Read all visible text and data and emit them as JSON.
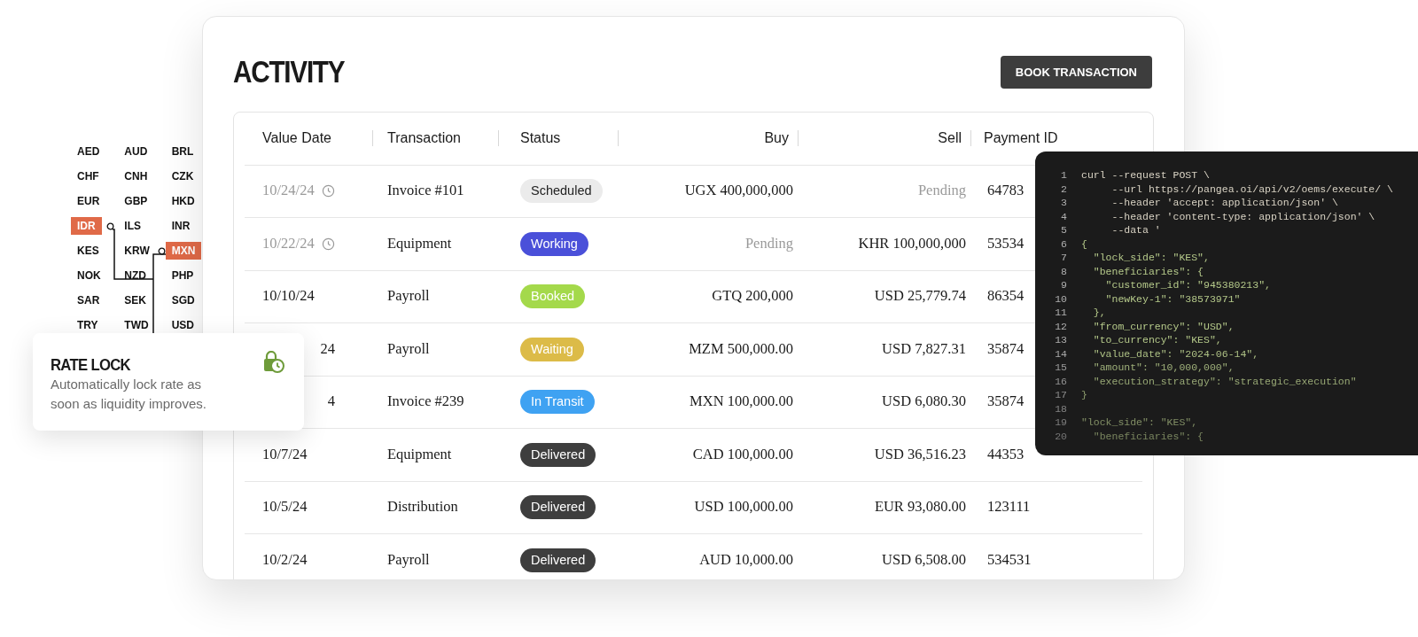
{
  "activity": {
    "title": "ACTIVITY",
    "book_button": "BOOK TRANSACTION",
    "columns": [
      "Value Date",
      "Transaction",
      "Status",
      "Buy",
      "Sell",
      "Payment ID"
    ],
    "rows": [
      {
        "date": "10/24/24",
        "scheduled": true,
        "clipped": false,
        "transaction": "Invoice #101",
        "status": "Scheduled",
        "color": "#ebebeb",
        "buy": "UGX 400,000,000",
        "buy_pending": false,
        "sell": "Pending",
        "sell_pending": true,
        "payment_id": "64783"
      },
      {
        "date": "10/22/24",
        "scheduled": true,
        "clipped": false,
        "transaction": "Equipment",
        "status": "Working",
        "color": "#4a50d9",
        "buy": "Pending",
        "buy_pending": true,
        "sell": "KHR 100,000,000",
        "sell_pending": false,
        "payment_id": "53534"
      },
      {
        "date": "10/10/24",
        "scheduled": false,
        "clipped": false,
        "transaction": "Payroll",
        "status": "Booked",
        "color": "#a4d94b",
        "buy": "GTQ 200,000",
        "buy_pending": false,
        "sell": "USD 25,779.74",
        "sell_pending": false,
        "payment_id": "86354"
      },
      {
        "date": "24",
        "scheduled": false,
        "clipped": true,
        "transaction": "Payroll",
        "status": "Waiting",
        "color": "#dcbb48",
        "buy": "MZM 500,000.00",
        "buy_pending": false,
        "sell": "USD 7,827.31",
        "sell_pending": false,
        "payment_id": "35874"
      },
      {
        "date": "4",
        "scheduled": false,
        "clipped": true,
        "transaction": "Invoice #239",
        "status": "In Transit",
        "color": "#3fa2f2",
        "buy": "MXN 100,000.00",
        "buy_pending": false,
        "sell": "USD 6,080.30",
        "sell_pending": false,
        "payment_id": "35874"
      },
      {
        "date": "10/7/24",
        "scheduled": false,
        "clipped": false,
        "transaction": "Equipment",
        "status": "Delivered",
        "color": "#3e3e3e",
        "buy": "CAD 100,000.00",
        "buy_pending": false,
        "sell": "USD 36,516.23",
        "sell_pending": false,
        "payment_id": "44353"
      },
      {
        "date": "10/5/24",
        "scheduled": false,
        "clipped": false,
        "transaction": "Distribution",
        "status": "Delivered",
        "color": "#3e3e3e",
        "buy": "USD 100,000.00",
        "buy_pending": false,
        "sell": "EUR 93,080.00",
        "sell_pending": false,
        "payment_id": "123111"
      },
      {
        "date": "10/2/24",
        "scheduled": false,
        "clipped": false,
        "transaction": "Payroll",
        "status": "Delivered",
        "color": "#3e3e3e",
        "buy": "AUD 10,000.00",
        "buy_pending": false,
        "sell": "USD 6,508.00",
        "sell_pending": false,
        "payment_id": "534531"
      }
    ]
  },
  "currencies": [
    [
      {
        "code": "AED",
        "selected": false
      },
      {
        "code": "AUD",
        "selected": false
      },
      {
        "code": "BRL",
        "selected": false
      }
    ],
    [
      {
        "code": "CHF",
        "selected": false
      },
      {
        "code": "CNH",
        "selected": false
      },
      {
        "code": "CZK",
        "selected": false
      }
    ],
    [
      {
        "code": "EUR",
        "selected": false
      },
      {
        "code": "GBP",
        "selected": false
      },
      {
        "code": "HKD",
        "selected": false
      }
    ],
    [
      {
        "code": "IDR",
        "selected": true
      },
      {
        "code": "ILS",
        "selected": false
      },
      {
        "code": "INR",
        "selected": false
      }
    ],
    [
      {
        "code": "KES",
        "selected": false
      },
      {
        "code": "KRW",
        "selected": false
      },
      {
        "code": "MXN",
        "selected": true
      }
    ],
    [
      {
        "code": "NOK",
        "selected": false
      },
      {
        "code": "NZD",
        "selected": false
      },
      {
        "code": "PHP",
        "selected": false
      }
    ],
    [
      {
        "code": "SAR",
        "selected": false
      },
      {
        "code": "SEK",
        "selected": false
      },
      {
        "code": "SGD",
        "selected": false
      }
    ],
    [
      {
        "code": "TRY",
        "selected": false
      },
      {
        "code": "TWD",
        "selected": false
      },
      {
        "code": "USD",
        "selected": false
      }
    ]
  ],
  "rate_lock": {
    "title": "RATE LOCK",
    "description": "Automatically lock rate as soon as liquidity improves."
  },
  "code": [
    {
      "number": "1",
      "text": "curl --request POST \\",
      "kind": "cmd"
    },
    {
      "number": "2",
      "text": "     --url https://pangea.oi/api/v2/oems/execute/ \\",
      "kind": "cmd"
    },
    {
      "number": "3",
      "text": "     --header 'accept: application/json' \\",
      "kind": "cmd"
    },
    {
      "number": "4",
      "text": "     --header 'content-type: application/json' \\",
      "kind": "cmd"
    },
    {
      "number": "5",
      "text": "     --data '",
      "kind": "cmd"
    },
    {
      "number": "6",
      "text": "{",
      "kind": "json"
    },
    {
      "number": "7",
      "text": "  \"lock_side\": \"KES\",",
      "kind": "json"
    },
    {
      "number": "8",
      "text": "  \"beneficiaries\": {",
      "kind": "json"
    },
    {
      "number": "9",
      "text": "    \"customer_id\": \"945380213\",",
      "kind": "json"
    },
    {
      "number": "10",
      "text": "    \"newKey-1\": \"38573971\"",
      "kind": "json"
    },
    {
      "number": "11",
      "text": "  },",
      "kind": "json"
    },
    {
      "number": "12",
      "text": "  \"from_currency\": \"USD\",",
      "kind": "json"
    },
    {
      "number": "13",
      "text": "  \"to_currency\": \"KES\",",
      "kind": "json"
    },
    {
      "number": "14",
      "text": "  \"value_date\": \"2024-06-14\",",
      "kind": "json"
    },
    {
      "number": "15",
      "text": "  \"amount\": \"10,000,000\",",
      "kind": "json"
    },
    {
      "number": "16",
      "text": "  \"execution_strategy\": \"strategic_execution\"",
      "kind": "json"
    },
    {
      "number": "17",
      "text": "}",
      "kind": "json"
    },
    {
      "number": "18",
      "kind": "blank"
    },
    {
      "number": "19",
      "text": "\"lock_side\": \"KES\",",
      "kind": "json"
    },
    {
      "number": "20",
      "text": "  \"beneficiaries\": {",
      "kind": "json"
    }
  ]
}
